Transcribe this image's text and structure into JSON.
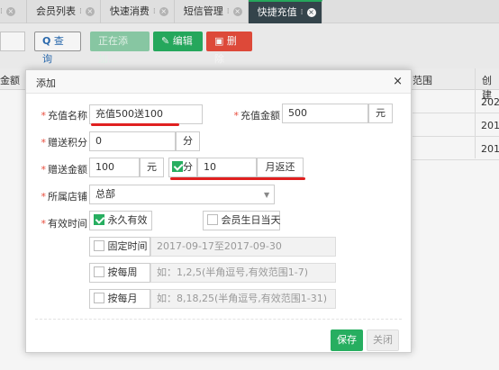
{
  "tabs": [
    {
      "label": "",
      "active": false
    },
    {
      "label": "会员列表",
      "active": false
    },
    {
      "label": "快速消费",
      "active": false
    },
    {
      "label": "短信管理",
      "active": false
    },
    {
      "label": "快捷充值",
      "active": true
    }
  ],
  "toolbar": {
    "search_label": "查询",
    "adding_label": "正在添加...",
    "edit_label": "编辑",
    "delete_label": "删除"
  },
  "grid": {
    "headers": {
      "left": "金额",
      "range": "范围",
      "created": "创建"
    },
    "rows": [
      "202",
      "201",
      "201"
    ]
  },
  "dialog": {
    "title": "添加",
    "close": "×",
    "fields": {
      "name_label": "充值名称",
      "name_value": "充值500送100",
      "amount_label": "充值金额",
      "amount_value": "500",
      "amount_unit": "元",
      "points_label": "赠送积分",
      "points_value": "0",
      "points_unit": "分",
      "gift_label": "赠送金额",
      "gift_value": "100",
      "gift_unit": "元",
      "gift_points_unit": "分",
      "gift_months_value": "10",
      "gift_months_unit": "月返还",
      "store_label": "所属店铺",
      "store_value": "总部",
      "valid_label": "有效时间",
      "forever_label": "永久有效",
      "birthday_label": "会员生日当天",
      "fixed_label": "固定时间",
      "fixed_value": "2017-09-17至2017-09-30",
      "weekly_label": "按每周",
      "weekly_placeholder": "如：1,2,5(半角逗号,有效范围1-7)",
      "monthly_label": "按每月",
      "monthly_placeholder": "如：8,18,25(半角逗号,有效范围1-31)"
    },
    "save_label": "保存",
    "close_label": "关闭"
  },
  "colors": {
    "accent_green": "#27ae60",
    "danger_red": "#e74c3c",
    "annotation_red": "#e02020",
    "active_tab": "#37474f"
  }
}
